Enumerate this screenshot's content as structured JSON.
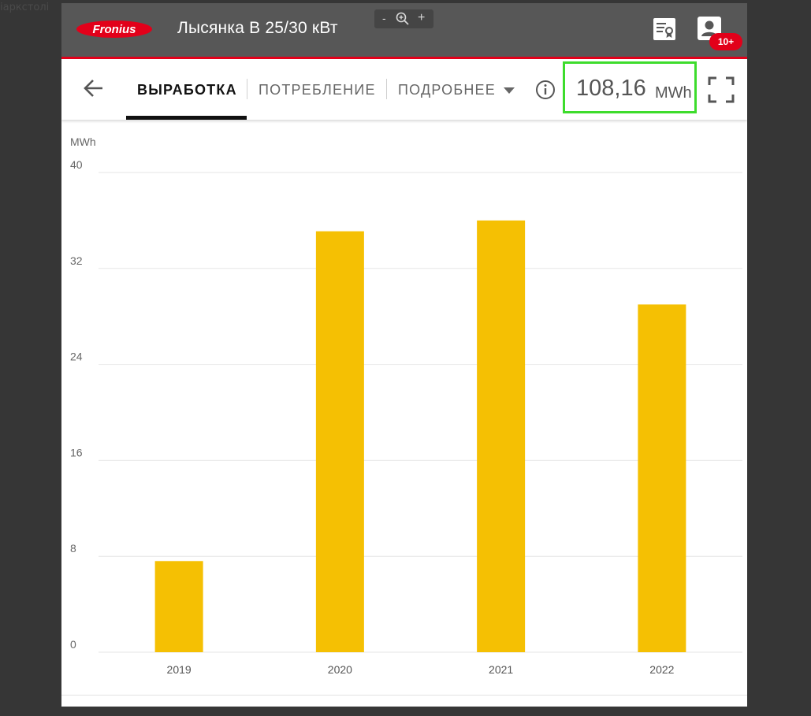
{
  "corner_text": "іаркстолі",
  "header": {
    "logo_text": "Fronius",
    "station_name": "Лысянка В 25/30 кВт",
    "zoom": {
      "minus": "-",
      "plus": "+"
    },
    "notifications_badge": "10+"
  },
  "nav": {
    "tabs": [
      {
        "label": "ВЫРАБОТКА",
        "active": true
      },
      {
        "label": "ПОТРЕБЛЕНИЕ",
        "active": false
      },
      {
        "label": "ПОДРОБНЕЕ",
        "active": false,
        "dropdown": true
      }
    ],
    "total_value": "108,16",
    "total_unit": "MWh"
  },
  "icons": {
    "logo": "fronius-logo-icon",
    "zoom": "zoom-in-icon",
    "report": "report-certificate-icon",
    "user": "user-icon",
    "back": "arrow-left-icon",
    "dropdown": "caret-down-icon",
    "info": "info-icon",
    "fullscreen": "fullscreen-icon"
  },
  "colors": {
    "header_bg": "#575757",
    "brand_red": "#e2001a",
    "bar": "#f5c003",
    "highlight_box": "#3ddc2c"
  },
  "chart_data": {
    "type": "bar",
    "ylabel": "MWh",
    "xlabel": "",
    "title": "",
    "categories": [
      "2019",
      "2020",
      "2021",
      "2022"
    ],
    "values": [
      7.6,
      35.1,
      36.0,
      29.0
    ],
    "ylim": [
      0,
      40
    ],
    "yticks": [
      "0",
      "8",
      "16",
      "24",
      "32",
      "40"
    ],
    "grid": true,
    "legend": "none"
  }
}
